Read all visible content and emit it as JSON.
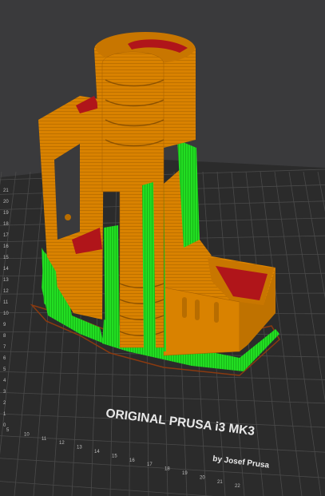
{
  "viewport": {
    "background": "#3a3a3c",
    "bed_color": "#2b2b2b",
    "grid_color": "#4a4a4a",
    "grid_minor_color": "#333333"
  },
  "bed": {
    "label_line1": "ORIGINAL PRUSA i3  MK3",
    "label_line2": "by Josef Prusa",
    "x_ticks": [
      "5",
      "10",
      "11",
      "12",
      "13",
      "14",
      "15",
      "16",
      "17",
      "18",
      "19",
      "20",
      "21",
      "22"
    ],
    "y_ticks": [
      "21",
      "20",
      "19",
      "18",
      "17",
      "16",
      "15",
      "14",
      "13",
      "12",
      "11",
      "10",
      "9",
      "8",
      "7",
      "6",
      "5",
      "4",
      "3",
      "2",
      "1",
      "0"
    ]
  },
  "model": {
    "color_perimeter": "#d98200",
    "color_support": "#22dd22",
    "color_top": "#cc1111",
    "color_outline": "#9a4a00"
  }
}
